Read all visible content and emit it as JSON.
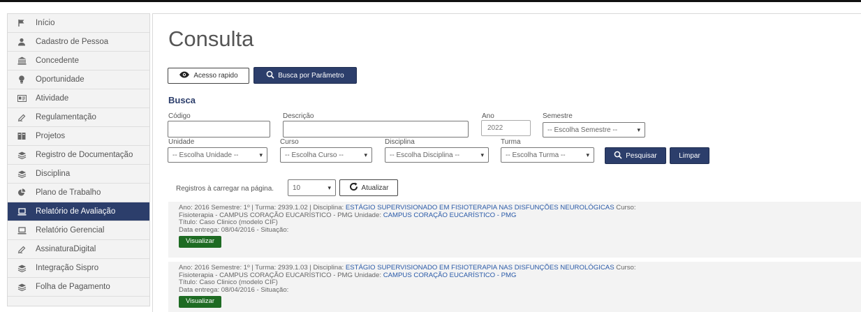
{
  "sidebar": {
    "items": [
      {
        "label": "Início",
        "icon": "flag-icon",
        "active": false
      },
      {
        "label": "Cadastro de Pessoa",
        "icon": "user-icon",
        "active": false
      },
      {
        "label": "Concedente",
        "icon": "bank-icon",
        "active": false
      },
      {
        "label": "Oportunidade",
        "icon": "lightbulb-icon",
        "active": false
      },
      {
        "label": "Atividade",
        "icon": "id-card-icon",
        "active": false
      },
      {
        "label": "Regulamentação",
        "icon": "pen-icon",
        "active": false
      },
      {
        "label": "Projetos",
        "icon": "folder-icon",
        "active": false
      },
      {
        "label": "Registro de Documentação",
        "icon": "layers-icon",
        "active": false
      },
      {
        "label": "Disciplina",
        "icon": "layers-icon",
        "active": false
      },
      {
        "label": "Plano de Trabalho",
        "icon": "pie-chart-icon",
        "active": false
      },
      {
        "label": "Relatório de Avaliação",
        "icon": "laptop-icon",
        "active": true
      },
      {
        "label": "Relatório Gerencial",
        "icon": "laptop-icon",
        "active": false
      },
      {
        "label": "AssinaturaDigital",
        "icon": "pen-icon",
        "active": false
      },
      {
        "label": "Integração Sispro",
        "icon": "layers-icon",
        "active": false
      },
      {
        "label": "Folha de Pagamento",
        "icon": "layers-icon",
        "active": false
      }
    ]
  },
  "page": {
    "title": "Consulta",
    "btn_acesso": "Acesso rapido",
    "btn_busca": "Busca por Parâmetro",
    "busca_heading": "Busca"
  },
  "form": {
    "codigo_label": "Código",
    "codigo_value": "",
    "descricao_label": "Descrição",
    "descricao_value": "",
    "ano_label": "Ano",
    "ano_value": "2022",
    "semestre_label": "Semestre",
    "semestre_value": "-- Escolha Semestre --",
    "unidade_label": "Unidade",
    "unidade_value": "-- Escolha Unidade --",
    "curso_label": "Curso",
    "curso_value": "-- Escolha Curso --",
    "disciplina_label": "Disciplina",
    "disciplina_value": "-- Escolha Disciplina --",
    "turma_label": "Turma",
    "turma_value": "-- Escolha Turma --",
    "pesquisar": "Pesquisar",
    "limpar": "Limpar"
  },
  "registros": {
    "label": "Registros à carregar na página.",
    "value": "10",
    "atualizar": "Atualizar"
  },
  "results": [
    {
      "line1_prefix": "Ano: 2016 Semestre: 1º | Turma: 2939.1.02 | Disciplina: ",
      "disciplina": "ESTÁGIO SUPERVISIONADO EM FISIOTERAPIA NAS DISFUNÇÕES NEUROLÓGICAS",
      "curso_label": " Curso:",
      "line2_prefix": "Fisioterapia - CAMPUS CORAÇÃO EUCARÍSTICO - PMG ",
      "unidade_label": "Unidade: ",
      "unidade": "CAMPUS CORAÇÃO EUCARÍSTICO - PMG",
      "titulo": "Título: Caso Clinico (modelo CIF)",
      "data": "Data entrega: 08/04/2016 - Situação:",
      "button": "Visualizar"
    },
    {
      "line1_prefix": "Ano: 2016 Semestre: 1º | Turma: 2939.1.03 | Disciplina: ",
      "disciplina": "ESTÁGIO SUPERVISIONADO EM FISIOTERAPIA NAS DISFUNÇÕES NEUROLÓGICAS",
      "curso_label": " Curso:",
      "line2_prefix": "Fisioterapia - CAMPUS CORAÇÃO EUCARÍSTICO - PMG ",
      "unidade_label": "Unidade: ",
      "unidade": "CAMPUS CORAÇÃO EUCARÍSTICO - PMG",
      "titulo": "Título: Caso Clinico (modelo CIF)",
      "data": "Data entrega: 08/04/2016 - Situação:",
      "button": "Visualizar"
    }
  ]
}
